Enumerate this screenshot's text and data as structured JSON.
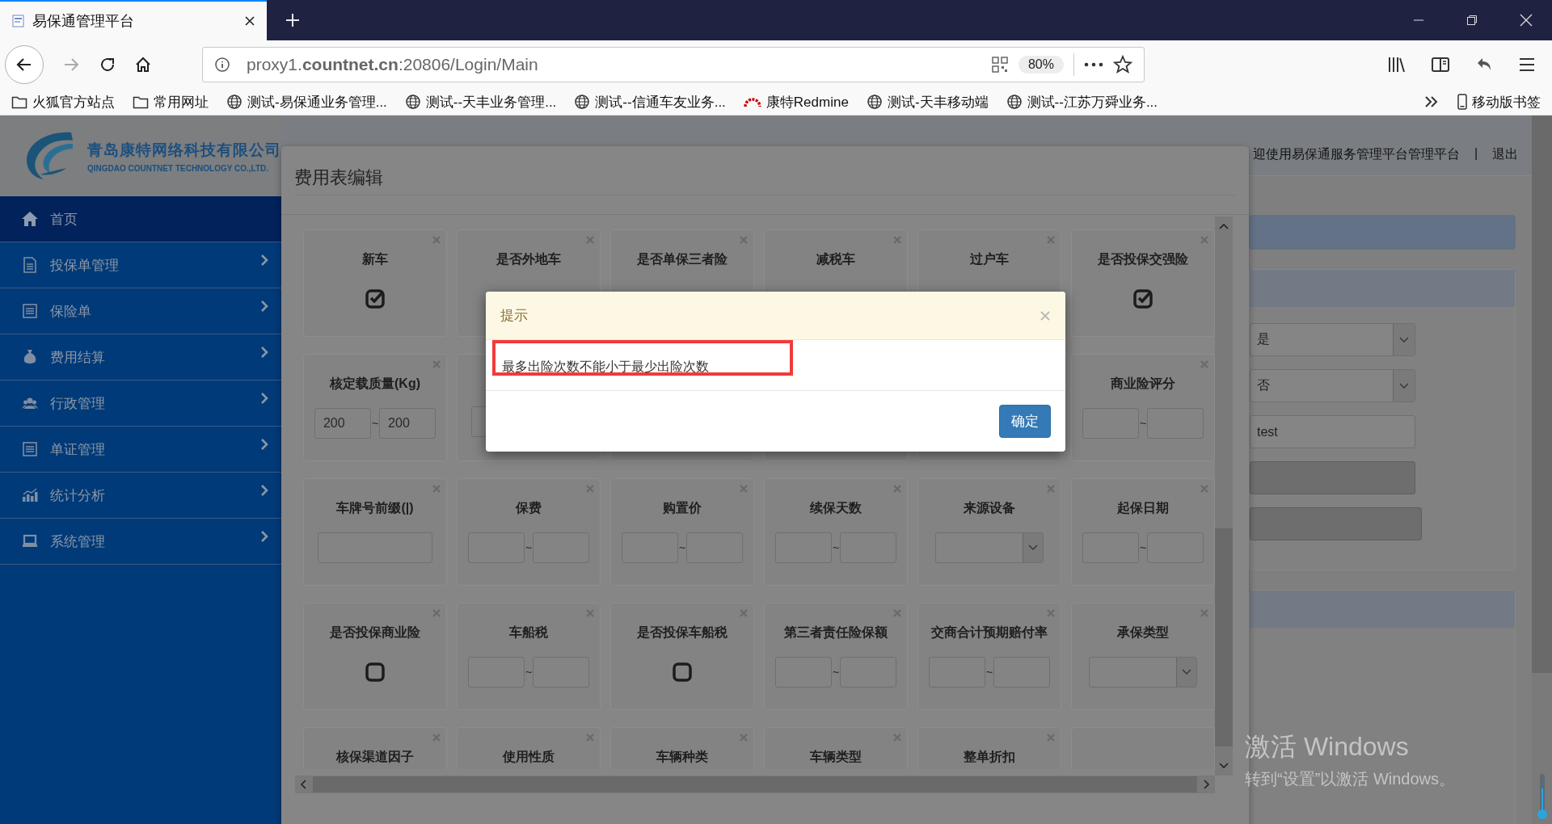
{
  "browser": {
    "tab_title": "易保通管理平台",
    "url": "proxy1.**countnet.cn**:20806/Login/Main",
    "zoom": "80%",
    "bookmarks": [
      {
        "label": "火狐官方站点",
        "kind": "folder"
      },
      {
        "label": "常用网址",
        "kind": "folder"
      },
      {
        "label": "测试-易保通业务管理...",
        "kind": "globe"
      },
      {
        "label": "测试--天丰业务管理...",
        "kind": "globe"
      },
      {
        "label": "测试--信通车友业务...",
        "kind": "globe"
      },
      {
        "label": "康特Redmine",
        "kind": "redmine"
      },
      {
        "label": "测试-天丰移动端",
        "kind": "globe"
      },
      {
        "label": "测试--江苏万舜业务...",
        "kind": "globe"
      }
    ],
    "mobile_bookmarks": "移动版书签"
  },
  "header": {
    "company": "青岛康特网络科技有限公司",
    "company_en": "QINGDAO COUNTNET TECHNOLOGY CO.,LTD.",
    "welcome": "迎使用易保通服务管理平台管理平台",
    "separator": "|",
    "logout": "退出"
  },
  "sidebar": {
    "items": [
      {
        "label": "首页",
        "selected": true,
        "expandable": false
      },
      {
        "label": "投保单管理",
        "selected": false,
        "expandable": true
      },
      {
        "label": "保险单",
        "selected": false,
        "expandable": true
      },
      {
        "label": "费用结算",
        "selected": false,
        "expandable": true
      },
      {
        "label": "行政管理",
        "selected": false,
        "expandable": true
      },
      {
        "label": "单证管理",
        "selected": false,
        "expandable": true
      },
      {
        "label": "统计分析",
        "selected": false,
        "expandable": true
      },
      {
        "label": "系统管理",
        "selected": false,
        "expandable": true
      }
    ]
  },
  "modal": {
    "title": "费用表编辑",
    "cards": [
      {
        "label": "新车",
        "kind": "checkbox",
        "checked": true
      },
      {
        "label": "是否外地车",
        "kind": "covered"
      },
      {
        "label": "是否单保三者险",
        "kind": "covered"
      },
      {
        "label": "减税车",
        "kind": "covered"
      },
      {
        "label": "过户车",
        "kind": "covered"
      },
      {
        "label": "是否投保交强险",
        "kind": "checkbox",
        "checked": true
      },
      {
        "label": "核定载质量(Kg)",
        "kind": "range",
        "from": "200",
        "sep": "~",
        "to": "200"
      },
      {
        "kind": "single-input"
      },
      {
        "kind": "covered"
      },
      {
        "kind": "covered"
      },
      {
        "kind": "covered"
      },
      {
        "label": "商业险评分",
        "kind": "range",
        "sep": "~"
      },
      {
        "label": "车牌号前缀(|)",
        "kind": "text"
      },
      {
        "label": "保费",
        "kind": "range",
        "sep": "~"
      },
      {
        "label": "购置价",
        "kind": "range",
        "sep": "~"
      },
      {
        "label": "续保天数",
        "kind": "range",
        "sep": "~"
      },
      {
        "label": "来源设备",
        "kind": "select"
      },
      {
        "label": "起保日期",
        "kind": "range",
        "sep": "~"
      },
      {
        "label": "是否投保商业险",
        "kind": "checkbox",
        "checked": false
      },
      {
        "label": "车船税",
        "kind": "range",
        "sep": "~"
      },
      {
        "label": "是否投保车船税",
        "kind": "checkbox",
        "checked": false
      },
      {
        "label": "第三者责任险保额",
        "kind": "range",
        "sep": "~"
      },
      {
        "label": "交商合计预期赔付率",
        "kind": "range",
        "sep": "~"
      },
      {
        "label": "承保类型",
        "kind": "select"
      },
      {
        "label": "核保渠道因子",
        "kind": "covered"
      },
      {
        "label": "使用性质",
        "kind": "covered"
      },
      {
        "label": "车辆种类",
        "kind": "covered"
      },
      {
        "label": "车辆类型",
        "kind": "covered"
      },
      {
        "label": "整单折扣",
        "kind": "covered"
      },
      {
        "kind": "covered"
      }
    ]
  },
  "dialog": {
    "title": "提示",
    "message": "最多出险次数不能小于最少出险次数",
    "ok": "确定"
  },
  "right_form": {
    "fields": [
      {
        "kind": "select",
        "value": "是"
      },
      {
        "kind": "select",
        "value": "否"
      },
      {
        "kind": "input",
        "value": "test",
        "disabled": false
      },
      {
        "kind": "input",
        "disabled": true
      },
      {
        "kind": "input",
        "disabled": true
      }
    ]
  },
  "os_notice": {
    "title": "激活 Windows",
    "text": "转到“设置”以激活 Windows。"
  }
}
